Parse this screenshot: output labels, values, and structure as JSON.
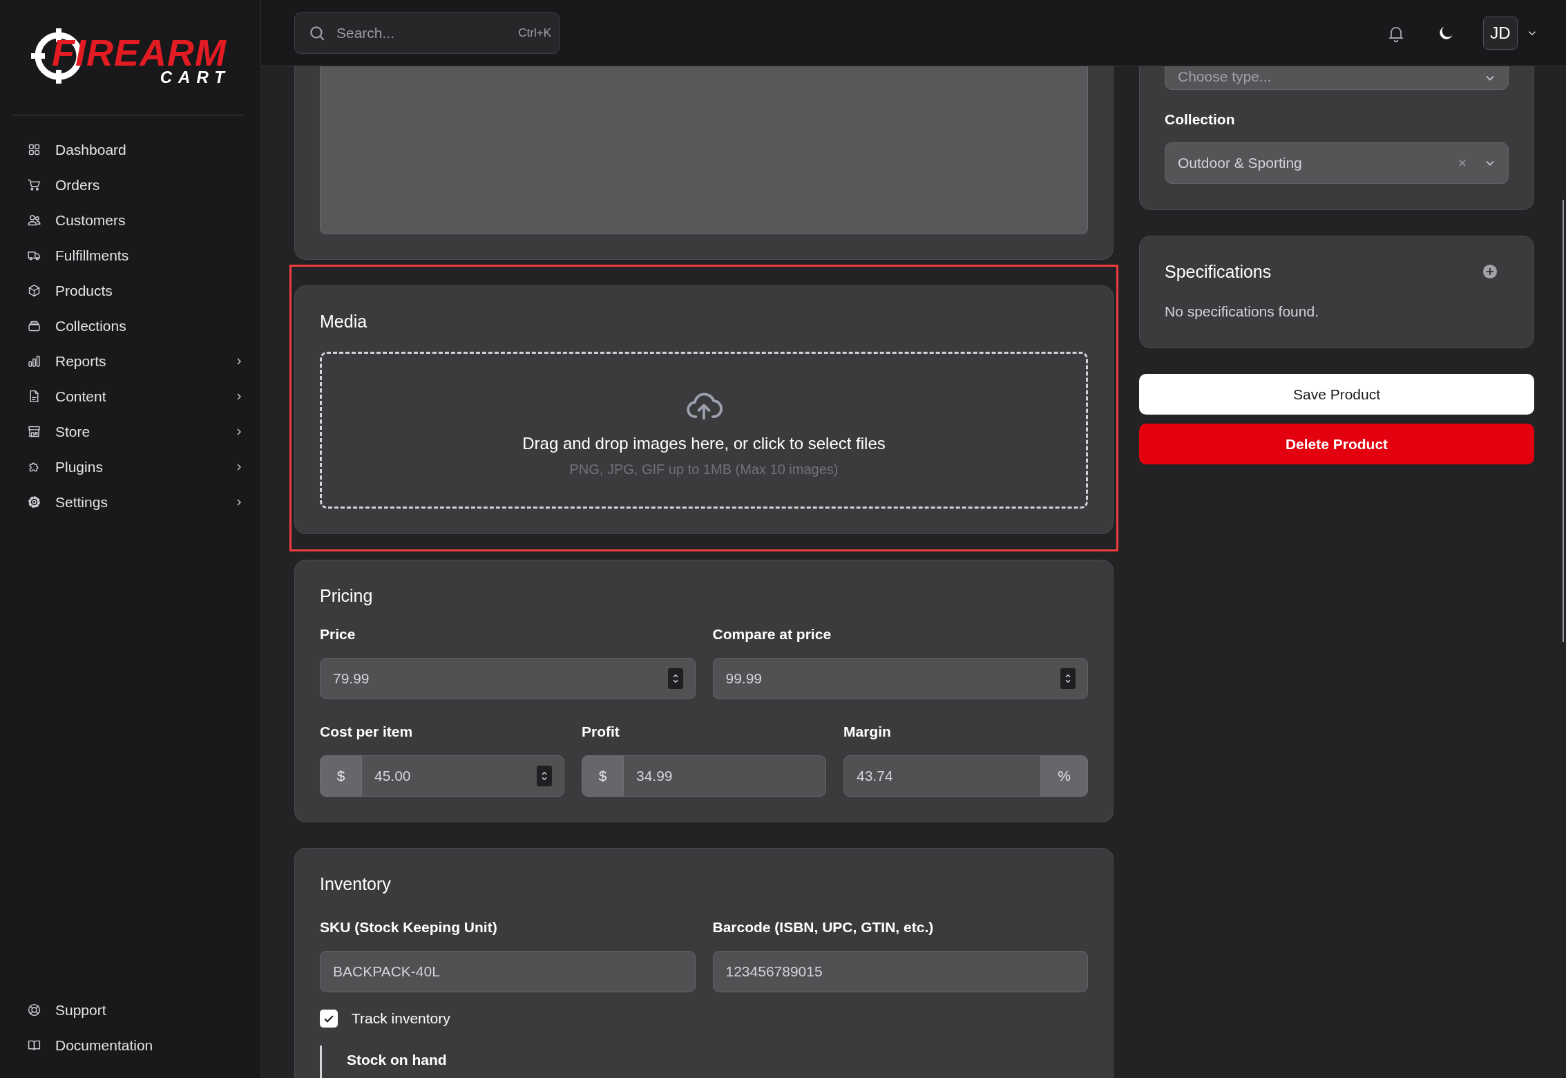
{
  "brand": {
    "name": "FIREARM",
    "tagline": "CART"
  },
  "nav": [
    {
      "label": "Dashboard",
      "has_children": false
    },
    {
      "label": "Orders",
      "has_children": false
    },
    {
      "label": "Customers",
      "has_children": false
    },
    {
      "label": "Fulfillments",
      "has_children": false
    },
    {
      "label": "Products",
      "has_children": false
    },
    {
      "label": "Collections",
      "has_children": false
    },
    {
      "label": "Reports",
      "has_children": true
    },
    {
      "label": "Content",
      "has_children": true
    },
    {
      "label": "Store",
      "has_children": true
    },
    {
      "label": "Plugins",
      "has_children": true
    },
    {
      "label": "Settings",
      "has_children": true
    }
  ],
  "footer_nav": [
    {
      "label": "Support"
    },
    {
      "label": "Documentation"
    }
  ],
  "topbar": {
    "search": {
      "placeholder": "Search...",
      "shortcut": "Ctrl+K"
    },
    "user_initials": "JD"
  },
  "media": {
    "title": "Media",
    "highlighted": true,
    "drop_text": "Drag and drop images here, or click to select files",
    "hint": "PNG, JPG, GIF up to 1MB (Max 10 images)"
  },
  "pricing": {
    "title": "Pricing",
    "rows": [
      [
        {
          "label": "Price",
          "value": "79.99",
          "has_stepper": true
        },
        {
          "label": "Compare at price",
          "value": "99.99",
          "has_stepper": true
        }
      ],
      [
        {
          "label": "Cost per item",
          "value": "45.00",
          "has_stepper": true,
          "prefix": "$"
        },
        {
          "label": "Profit",
          "value": "34.99",
          "has_stepper": false,
          "prefix": "$"
        },
        {
          "label": "Margin",
          "value": "43.74",
          "has_stepper": false,
          "suffix": "%"
        }
      ]
    ]
  },
  "inventory": {
    "title": "Inventory",
    "fields": [
      {
        "label": "SKU (Stock Keeping Unit)",
        "value": "BACKPACK-40L",
        "has_stepper": false
      },
      {
        "label": "Barcode (ISBN, UPC, GTIN, etc.)",
        "value": "123456789015",
        "has_stepper": false
      }
    ],
    "track_inventory": {
      "label": "Track inventory",
      "checked": true
    },
    "stock_label": "Stock on hand"
  },
  "organization": {
    "type_placeholder": "Choose type...",
    "collection_label": "Collection",
    "collection_value": "Outdoor & Sporting"
  },
  "specifications": {
    "title": "Specifications",
    "empty_text": "No specifications found."
  },
  "actions": [
    {
      "label": "Save Product",
      "kind": "primary"
    },
    {
      "label": "Delete Product",
      "kind": "danger"
    }
  ]
}
